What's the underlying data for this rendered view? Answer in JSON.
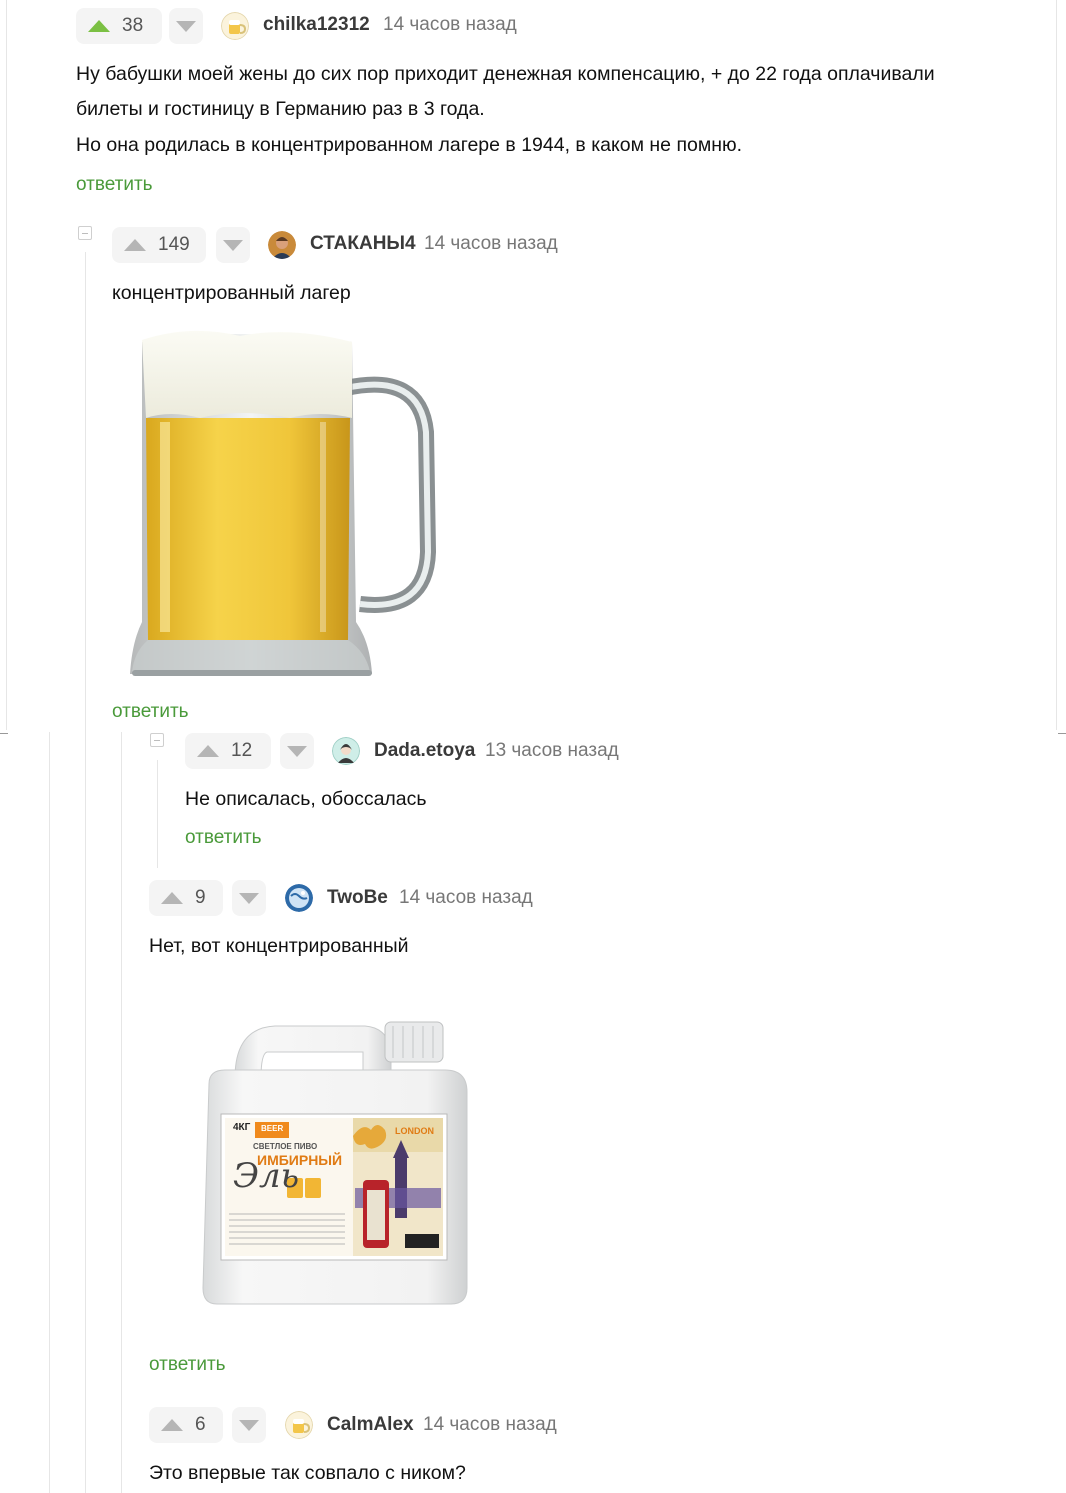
{
  "colors": {
    "accent_green": "#4a9a3a",
    "vote_up_active": "#7bc043",
    "vote_arrow": "#b5b5b5",
    "pill_bg": "#f4f4f4",
    "rail": "#e6e6e6"
  },
  "comments": [
    {
      "rating": "38",
      "author": "chilka12312",
      "time": "14 часов назад",
      "lines": [
        "Ну бабушки моей жены до сих пор приходит денежная компенсацию, + до 22 года оплачивали",
        "билеты и гостиницу в Германию раз в 3 года.",
        "Но она родилась в концентрированном лагере в 1944, в каком не помню."
      ],
      "reply_label": "ответить",
      "avatar_icon": "beer-avatar-icon"
    },
    {
      "rating": "149",
      "author": "СТАКАНЫ4",
      "time": "14 часов назад",
      "lines": [
        "концентрированный лагер"
      ],
      "reply_label": "ответить",
      "image": "beer-mug-image",
      "avatar_icon": "man-photo-avatar-icon"
    },
    {
      "rating": "12",
      "author": "Dada.etoya",
      "time": "13 часов назад",
      "lines": [
        "Не описалась, обоссалась"
      ],
      "reply_label": "ответить",
      "avatar_icon": "girl-drawing-avatar-icon"
    },
    {
      "rating": "9",
      "author": "TwoBe",
      "time": "14 часов назад",
      "lines": [
        "Нет, вот концентрированный"
      ],
      "reply_label": "ответить",
      "image": "beer-concentrate-canister-image",
      "avatar_icon": "globe-avatar-icon"
    },
    {
      "rating": "6",
      "author": "CalmAlex",
      "time": "14 часов назад",
      "lines": [
        "Это впервые так совпало с ником?"
      ],
      "avatar_icon": "beer-avatar-icon"
    }
  ],
  "canister_label": {
    "weight": "4КГ",
    "brand": "BEER",
    "kind": "СВЕТЛОЕ ПИВО",
    "name_line1": "ИМБИРНЫЙ",
    "name_script": "Эль",
    "city": "LONDON"
  }
}
